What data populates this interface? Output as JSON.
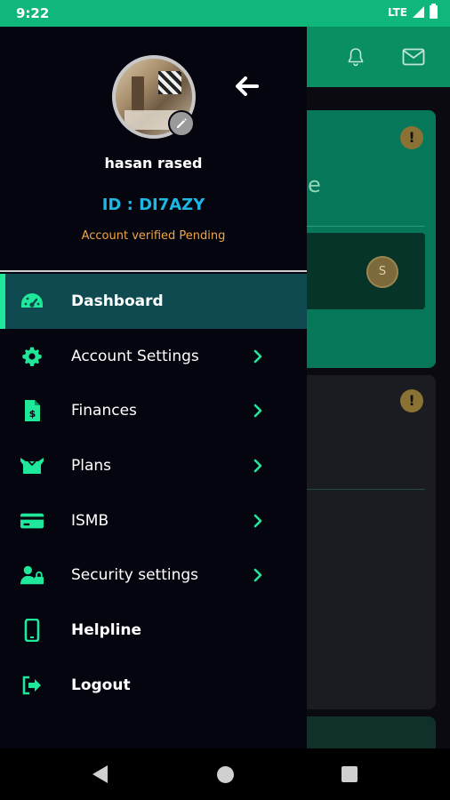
{
  "status_bar": {
    "time": "9:22",
    "network": "LTE"
  },
  "background": {
    "partial_text": "e",
    "coin_label": "S"
  },
  "drawer": {
    "user_name": "hasan rased",
    "user_id": "ID : DI7AZY",
    "verification_status": "Account verified Pending",
    "menu": [
      {
        "label": "Dashboard",
        "icon": "dashboard-gauge-icon",
        "active": true,
        "has_chevron": false
      },
      {
        "label": "Account Settings",
        "icon": "gear-icon",
        "active": false,
        "has_chevron": true
      },
      {
        "label": "Finances",
        "icon": "invoice-dollar-icon",
        "active": false,
        "has_chevron": true
      },
      {
        "label": "Plans",
        "icon": "box-icon",
        "active": false,
        "has_chevron": true
      },
      {
        "label": "ISMB",
        "icon": "credit-card-icon",
        "active": false,
        "has_chevron": true
      },
      {
        "label": "Security settings",
        "icon": "user-lock-icon",
        "active": false,
        "has_chevron": true
      },
      {
        "label": "Helpline",
        "icon": "phone-icon",
        "active": false,
        "has_chevron": false
      },
      {
        "label": "Logout",
        "icon": "sign-out-icon",
        "active": false,
        "has_chevron": false
      }
    ]
  },
  "colors": {
    "accent_green": "#20e89a",
    "status_bar": "#0fb87a",
    "user_id": "#1eb7e3",
    "verification_warning": "#f2a541",
    "active_item_bg": "#0e4a50"
  }
}
